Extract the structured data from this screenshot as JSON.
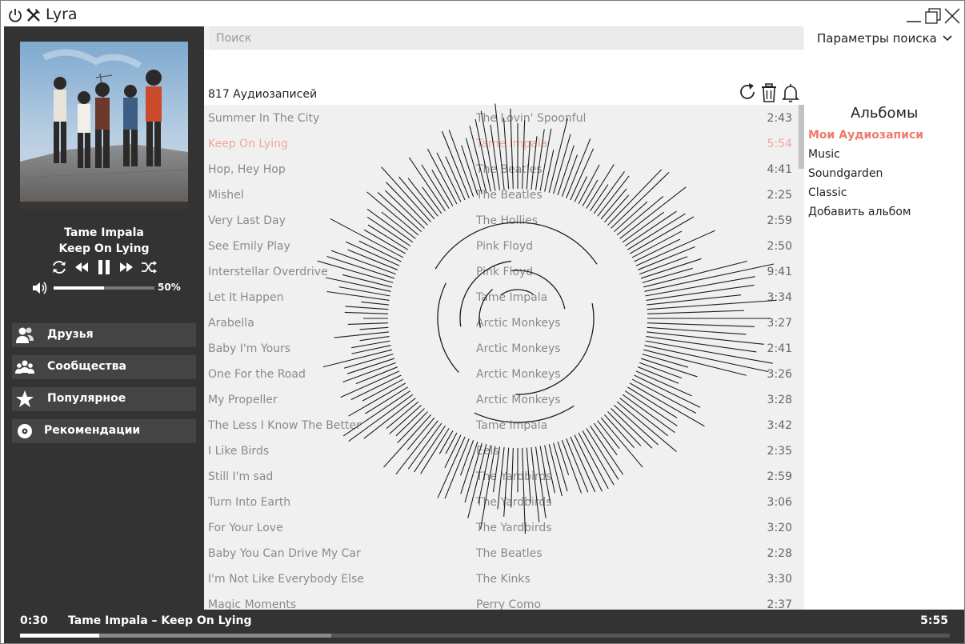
{
  "app": {
    "title": "Lyra"
  },
  "search": {
    "placeholder": "Поиск",
    "params_label": "Параметры поиска"
  },
  "now_playing": {
    "artist": "Tame Impala",
    "title": "Keep On Lying",
    "volume": 0.5,
    "volume_label": "50%"
  },
  "nav": [
    {
      "label": "Друзья",
      "icon": "friends-icon"
    },
    {
      "label": "Сообщества",
      "icon": "groups-icon"
    },
    {
      "label": "Популярное",
      "icon": "star-icon"
    },
    {
      "label": "Рекомендации",
      "icon": "disc-icon"
    }
  ],
  "tracklist": {
    "count_label": "817 Аудиозаписей",
    "tracks": [
      {
        "title": "Summer In The City",
        "artist": "The Lovin' Spoonful",
        "duration": "2:43"
      },
      {
        "title": "Keep On Lying",
        "artist": "Tame Impala",
        "duration": "5:54",
        "active": true
      },
      {
        "title": "Hop, Hey Hop",
        "artist": "The Beatles",
        "duration": "4:41"
      },
      {
        "title": "Mishel",
        "artist": "The Beatles",
        "duration": "2:25"
      },
      {
        "title": "Very Last Day",
        "artist": "The Hollies",
        "duration": "2:59"
      },
      {
        "title": "See Emily Play",
        "artist": "Pink Floyd",
        "duration": "2:50"
      },
      {
        "title": "Interstellar Overdrive",
        "artist": "Pink Floyd",
        "duration": "9:41"
      },
      {
        "title": "Let It Happen",
        "artist": "Tame Impala",
        "duration": "3:34"
      },
      {
        "title": "Arabella",
        "artist": "Arctic Monkeys",
        "duration": "3:27"
      },
      {
        "title": "Baby I'm Yours",
        "artist": "Arctic Monkeys",
        "duration": "2:41"
      },
      {
        "title": "One For the Road",
        "artist": "Arctic Monkeys",
        "duration": "3:26"
      },
      {
        "title": "My Propeller",
        "artist": "Arctic Monkeys",
        "duration": "3:28"
      },
      {
        "title": "The Less I Know The Better",
        "artist": "Tame Impala",
        "duration": "3:42"
      },
      {
        "title": "I Like Birds",
        "artist": "Eels",
        "duration": "2:35"
      },
      {
        "title": "Still I'm sad",
        "artist": "The Yardbirds",
        "duration": "2:59"
      },
      {
        "title": "Turn Into Earth",
        "artist": "The Yardbirds",
        "duration": "3:06"
      },
      {
        "title": "For Your Love",
        "artist": "The Yardbirds",
        "duration": "3:20"
      },
      {
        "title": "Baby You Can Drive My Car",
        "artist": "The Beatles",
        "duration": "2:28"
      },
      {
        "title": "I'm Not Like Everybody Else",
        "artist": "The Kinks",
        "duration": "3:30"
      },
      {
        "title": "Magic Moments",
        "artist": "Perry Como",
        "duration": "2:37"
      }
    ]
  },
  "albums": {
    "title": "Альбомы",
    "items": [
      {
        "label": "Мои Аудиозаписи",
        "active": true
      },
      {
        "label": "Music"
      },
      {
        "label": "Soundgarden"
      },
      {
        "label": "Classic"
      },
      {
        "label": "Добавить альбом"
      }
    ]
  },
  "player": {
    "current_time": "0:30",
    "track_label": "Tame Impala – Keep On Lying",
    "total_time": "5:55",
    "progress": 0.085,
    "buffered": 0.335
  },
  "colors": {
    "sidebar": "#333333",
    "nav_item": "#444444",
    "accent": "#f07a69",
    "list_bg": "#f0f0f0"
  }
}
